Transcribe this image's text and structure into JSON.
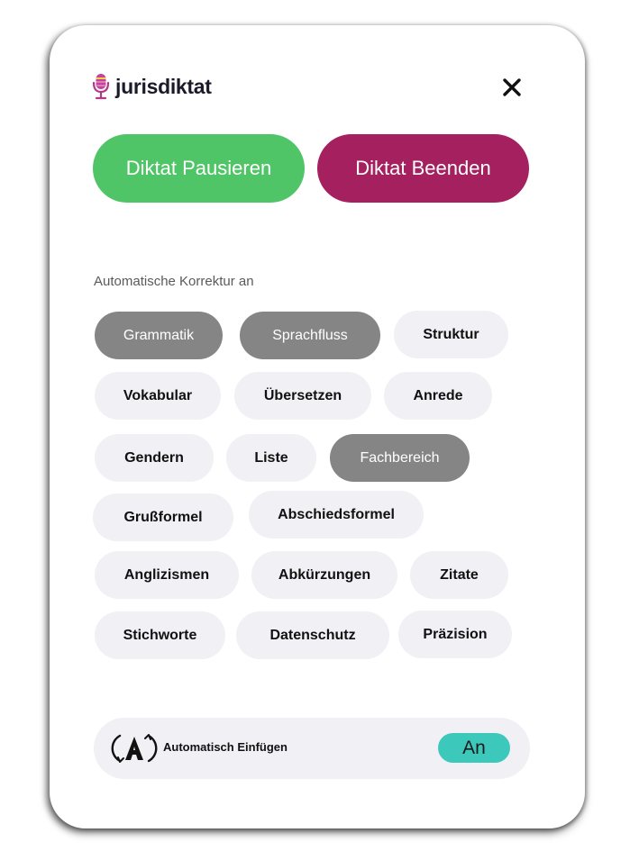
{
  "header": {
    "logo_text": "jurisdiktat",
    "logo_icon": "microphone-icon",
    "close_icon": "close-icon"
  },
  "actions": {
    "pause_label": "Diktat Pausieren",
    "end_label": "Diktat Beenden"
  },
  "correction": {
    "section_label": "Automatische Korrektur an",
    "chips": [
      {
        "label": "Grammatik",
        "active": true
      },
      {
        "label": "Sprachfluss",
        "active": true
      },
      {
        "label": "Struktur",
        "active": false
      },
      {
        "label": "Vokabular",
        "active": false
      },
      {
        "label": "Übersetzen",
        "active": false
      },
      {
        "label": "Anrede",
        "active": false
      },
      {
        "label": "Gendern",
        "active": false
      },
      {
        "label": "Liste",
        "active": false
      },
      {
        "label": "Fachbereich",
        "active": true
      },
      {
        "label": "Grußformel",
        "active": false
      },
      {
        "label": "Abschiedsformel",
        "active": false
      },
      {
        "label": "Anglizismen",
        "active": false
      },
      {
        "label": "Abkürzungen",
        "active": false
      },
      {
        "label": "Zitate",
        "active": false
      },
      {
        "label": "Stichworte",
        "active": false
      },
      {
        "label": "Datenschutz",
        "active": false
      },
      {
        "label": "Präzision",
        "active": false
      }
    ]
  },
  "auto_insert": {
    "icon": "auto-insert-icon",
    "label": "Automatisch Einfügen",
    "toggle_label": "An"
  },
  "colors": {
    "pause": "#4fc567",
    "end": "#a4205f",
    "chip_active": "#858585",
    "chip_inactive": "#f0f0f5",
    "toggle_on": "#3cc8bb"
  }
}
